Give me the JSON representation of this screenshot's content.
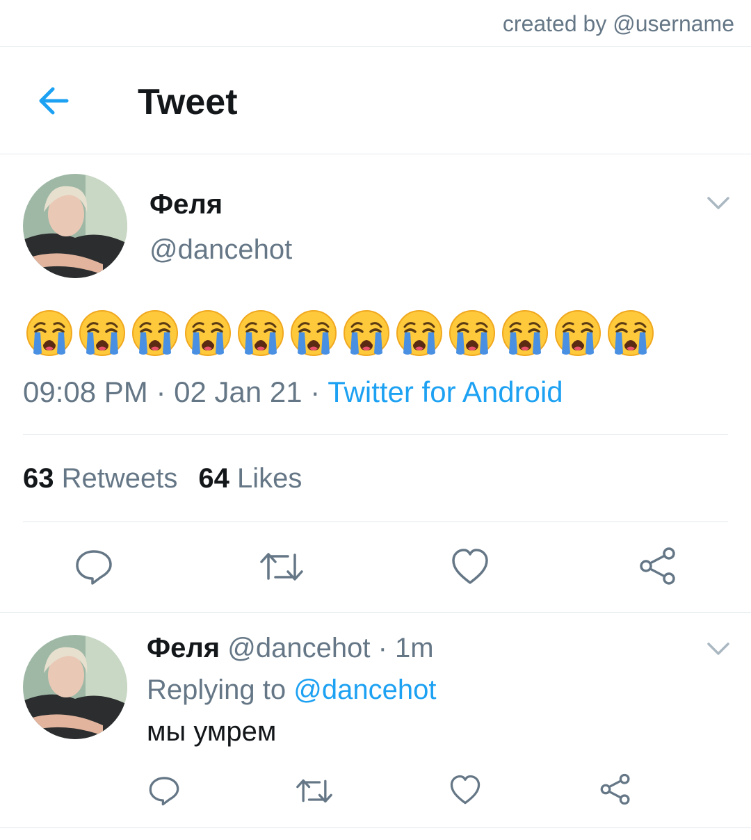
{
  "credit": "created by @username",
  "header": {
    "title": "Tweet"
  },
  "tweet": {
    "name": "Феля",
    "handle": "@dancehot",
    "emoji_count": 12,
    "time": "09:08 PM",
    "date": "02 Jan 21",
    "source": "Twitter for Android",
    "retweets_count": "63",
    "retweets_label": "Retweets",
    "likes_count": "64",
    "likes_label": "Likes"
  },
  "reply": {
    "name": "Феля",
    "handle": "@dancehot",
    "age": "1m",
    "replying_label": "Replying to",
    "replying_to": "@dancehot",
    "text": "мы умрем"
  },
  "icons": {
    "back": "arrow-left-icon",
    "more": "chevron-down-icon",
    "reply": "comment-icon",
    "retweet": "retweet-icon",
    "like": "heart-icon",
    "share": "share-icon",
    "emoji": "loudly-crying-face-icon"
  },
  "colors": {
    "accent": "#1da1f2",
    "text_primary": "#14171a",
    "text_secondary": "#657786",
    "divider": "#e1e8ed"
  }
}
